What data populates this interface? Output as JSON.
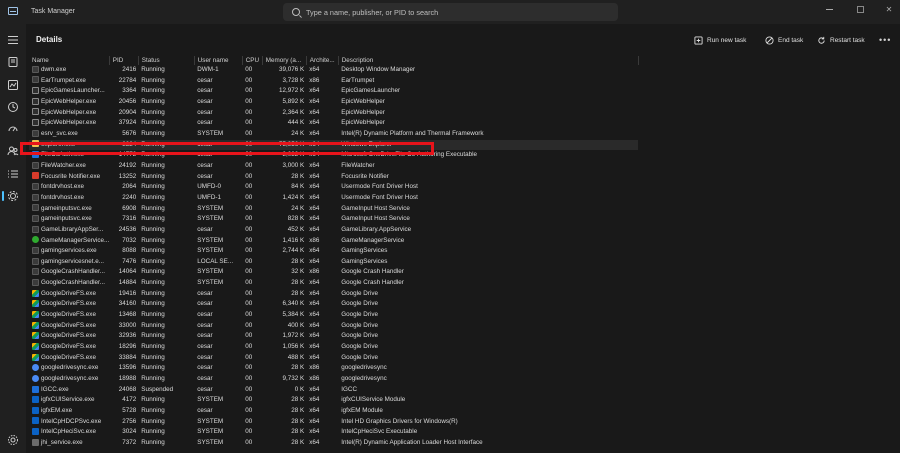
{
  "window": {
    "title": "Task Manager"
  },
  "search": {
    "placeholder": "Type a name, publisher, or PID to search"
  },
  "page": {
    "title": "Details"
  },
  "commands": {
    "run_new_task": "Run new task",
    "end_task": "End task",
    "restart_task": "Restart task"
  },
  "columns": [
    "Name",
    "PID",
    "Status",
    "User name",
    "CPU",
    "Memory (a...",
    "Archite...",
    "Description"
  ],
  "rows": [
    {
      "name": "dwm.exe",
      "pid": "2416",
      "status": "Running",
      "user": "DWM-1",
      "cpu": "00",
      "memory": "39,076 K",
      "arch": "x64",
      "desc": "Desktop Window Manager",
      "icon": "window"
    },
    {
      "name": "EarTrumpet.exe",
      "pid": "22784",
      "status": "Running",
      "user": "cesar",
      "cpu": "00",
      "memory": "3,728 K",
      "arch": "x86",
      "desc": "EarTrumpet",
      "icon": "window"
    },
    {
      "name": "EpicGamesLauncher...",
      "pid": "3364",
      "status": "Running",
      "user": "cesar",
      "cpu": "00",
      "memory": "12,972 K",
      "arch": "x64",
      "desc": "EpicGamesLauncher",
      "icon": "epic"
    },
    {
      "name": "EpicWebHelper.exe",
      "pid": "20456",
      "status": "Running",
      "user": "cesar",
      "cpu": "00",
      "memory": "5,892 K",
      "arch": "x64",
      "desc": "EpicWebHelper",
      "icon": "epic"
    },
    {
      "name": "EpicWebHelper.exe",
      "pid": "20904",
      "status": "Running",
      "user": "cesar",
      "cpu": "00",
      "memory": "2,364 K",
      "arch": "x64",
      "desc": "EpicWebHelper",
      "icon": "epic"
    },
    {
      "name": "EpicWebHelper.exe",
      "pid": "37924",
      "status": "Running",
      "user": "cesar",
      "cpu": "00",
      "memory": "444 K",
      "arch": "x64",
      "desc": "EpicWebHelper",
      "icon": "epic"
    },
    {
      "name": "esrv_svc.exe",
      "pid": "5676",
      "status": "Running",
      "user": "SYSTEM",
      "cpu": "00",
      "memory": "24 K",
      "arch": "x64",
      "desc": "Intel(R) Dynamic Platform and Thermal Framework",
      "icon": "window"
    },
    {
      "name": "explorer.exe",
      "pid": "8324",
      "status": "Running",
      "user": "cesar",
      "cpu": "00",
      "memory": "75,956 K",
      "arch": "x64",
      "desc": "Windows Explorer",
      "icon": "folder",
      "selected": true
    },
    {
      "name": "FileCoAuth.exe",
      "pid": "14772",
      "status": "Running",
      "user": "cesar",
      "cpu": "00",
      "memory": "2,032 K",
      "arch": "x64",
      "desc": "Microsoft OneDriveFile Co-Authoring Executable",
      "icon": "blue"
    },
    {
      "name": "FileWatcher.exe",
      "pid": "24192",
      "status": "Running",
      "user": "cesar",
      "cpu": "00",
      "memory": "3,000 K",
      "arch": "x64",
      "desc": "FileWatcher",
      "icon": "window"
    },
    {
      "name": "Focusrite Notifier.exe",
      "pid": "13252",
      "status": "Running",
      "user": "cesar",
      "cpu": "00",
      "memory": "28 K",
      "arch": "x64",
      "desc": "Focusrite Notifier",
      "icon": "red"
    },
    {
      "name": "fontdrvhost.exe",
      "pid": "2064",
      "status": "Running",
      "user": "UMFD-0",
      "cpu": "00",
      "memory": "84 K",
      "arch": "x64",
      "desc": "Usermode Font Driver Host",
      "icon": "window"
    },
    {
      "name": "fontdrvhost.exe",
      "pid": "2240",
      "status": "Running",
      "user": "UMFD-1",
      "cpu": "00",
      "memory": "1,424 K",
      "arch": "x64",
      "desc": "Usermode Font Driver Host",
      "icon": "window"
    },
    {
      "name": "gameinputsvc.exe",
      "pid": "6908",
      "status": "Running",
      "user": "SYSTEM",
      "cpu": "00",
      "memory": "24 K",
      "arch": "x64",
      "desc": "GameInput Host Service",
      "icon": "window"
    },
    {
      "name": "gameinputsvc.exe",
      "pid": "7316",
      "status": "Running",
      "user": "SYSTEM",
      "cpu": "00",
      "memory": "828 K",
      "arch": "x64",
      "desc": "GameInput Host Service",
      "icon": "window"
    },
    {
      "name": "GameLibraryAppSer...",
      "pid": "24536",
      "status": "Running",
      "user": "cesar",
      "cpu": "00",
      "memory": "452 K",
      "arch": "x64",
      "desc": "GameLibrary.AppService",
      "icon": "window"
    },
    {
      "name": "GameManagerService...",
      "pid": "7032",
      "status": "Running",
      "user": "SYSTEM",
      "cpu": "00",
      "memory": "1,416 K",
      "arch": "x86",
      "desc": "GameManagerService",
      "icon": "green"
    },
    {
      "name": "gamingservices.exe",
      "pid": "8088",
      "status": "Running",
      "user": "SYSTEM",
      "cpu": "00",
      "memory": "2,744 K",
      "arch": "x64",
      "desc": "GamingServices",
      "icon": "window"
    },
    {
      "name": "gamingservicesnet.e...",
      "pid": "7476",
      "status": "Running",
      "user": "LOCAL SE...",
      "cpu": "00",
      "memory": "28 K",
      "arch": "x64",
      "desc": "GamingServices",
      "icon": "window"
    },
    {
      "name": "GoogleCrashHandler...",
      "pid": "14064",
      "status": "Running",
      "user": "SYSTEM",
      "cpu": "00",
      "memory": "32 K",
      "arch": "x86",
      "desc": "Google Crash Handler",
      "icon": "window"
    },
    {
      "name": "GoogleCrashHandler...",
      "pid": "14884",
      "status": "Running",
      "user": "SYSTEM",
      "cpu": "00",
      "memory": "28 K",
      "arch": "x64",
      "desc": "Google Crash Handler",
      "icon": "window"
    },
    {
      "name": "GoogleDriveFS.exe",
      "pid": "19416",
      "status": "Running",
      "user": "cesar",
      "cpu": "00",
      "memory": "28 K",
      "arch": "x64",
      "desc": "Google Drive",
      "icon": "gdrive"
    },
    {
      "name": "GoogleDriveFS.exe",
      "pid": "34160",
      "status": "Running",
      "user": "cesar",
      "cpu": "00",
      "memory": "6,340 K",
      "arch": "x64",
      "desc": "Google Drive",
      "icon": "gdrive"
    },
    {
      "name": "GoogleDriveFS.exe",
      "pid": "13468",
      "status": "Running",
      "user": "cesar",
      "cpu": "00",
      "memory": "5,384 K",
      "arch": "x64",
      "desc": "Google Drive",
      "icon": "gdrive"
    },
    {
      "name": "GoogleDriveFS.exe",
      "pid": "33000",
      "status": "Running",
      "user": "cesar",
      "cpu": "00",
      "memory": "400 K",
      "arch": "x64",
      "desc": "Google Drive",
      "icon": "gdrive"
    },
    {
      "name": "GoogleDriveFS.exe",
      "pid": "32936",
      "status": "Running",
      "user": "cesar",
      "cpu": "00",
      "memory": "1,972 K",
      "arch": "x64",
      "desc": "Google Drive",
      "icon": "gdrive"
    },
    {
      "name": "GoogleDriveFS.exe",
      "pid": "18296",
      "status": "Running",
      "user": "cesar",
      "cpu": "00",
      "memory": "1,056 K",
      "arch": "x64",
      "desc": "Google Drive",
      "icon": "gdrive"
    },
    {
      "name": "GoogleDriveFS.exe",
      "pid": "33884",
      "status": "Running",
      "user": "cesar",
      "cpu": "00",
      "memory": "488 K",
      "arch": "x64",
      "desc": "Google Drive",
      "icon": "gdrive"
    },
    {
      "name": "googledrivesync.exe",
      "pid": "13596",
      "status": "Running",
      "user": "cesar",
      "cpu": "00",
      "memory": "28 K",
      "arch": "x86",
      "desc": "googledrivesync",
      "icon": "gsync"
    },
    {
      "name": "googledrivesync.exe",
      "pid": "18988",
      "status": "Running",
      "user": "cesar",
      "cpu": "00",
      "memory": "9,732 K",
      "arch": "x86",
      "desc": "googledrivesync",
      "icon": "gsync"
    },
    {
      "name": "IGCC.exe",
      "pid": "24068",
      "status": "Suspended",
      "user": "cesar",
      "cpu": "00",
      "memory": "0 K",
      "arch": "x64",
      "desc": "IGCC",
      "icon": "blue"
    },
    {
      "name": "igfxCUIService.exe",
      "pid": "4172",
      "status": "Running",
      "user": "SYSTEM",
      "cpu": "00",
      "memory": "28 K",
      "arch": "x64",
      "desc": "igfxCUIService Module",
      "icon": "intel"
    },
    {
      "name": "igfxEM.exe",
      "pid": "5728",
      "status": "Running",
      "user": "cesar",
      "cpu": "00",
      "memory": "28 K",
      "arch": "x64",
      "desc": "igfxEM Module",
      "icon": "intel"
    },
    {
      "name": "IntelCpHDCPSvc.exe",
      "pid": "2756",
      "status": "Running",
      "user": "SYSTEM",
      "cpu": "00",
      "memory": "28 K",
      "arch": "x64",
      "desc": "Intel HD Graphics Drivers for Windows(R)",
      "icon": "intel"
    },
    {
      "name": "IntelCpHeciSvc.exe",
      "pid": "3024",
      "status": "Running",
      "user": "SYSTEM",
      "cpu": "00",
      "memory": "28 K",
      "arch": "x64",
      "desc": "IntelCpHeciSvc Executable",
      "icon": "intel"
    },
    {
      "name": "jhi_service.exe",
      "pid": "7372",
      "status": "Running",
      "user": "SYSTEM",
      "cpu": "00",
      "memory": "28 K",
      "arch": "x64",
      "desc": "Intel(R) Dynamic Application Loader Host Interface",
      "icon": "gray"
    }
  ],
  "colors": {
    "accent": "#4cc2ff",
    "highlight": "#e8141b",
    "background": "#191919"
  }
}
